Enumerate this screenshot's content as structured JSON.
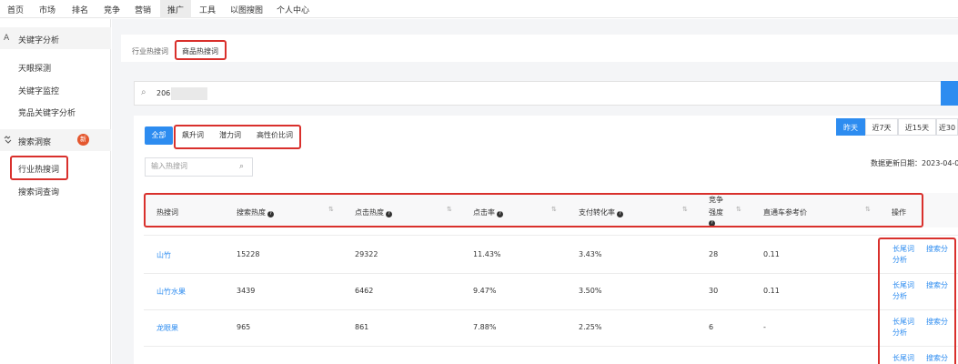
{
  "topnav": {
    "items": [
      "首页",
      "市场",
      "排名",
      "竞争",
      "营销",
      "推广",
      "工具",
      "以图搜图",
      "个人中心"
    ],
    "active_index": 5
  },
  "sidebar": {
    "group1": {
      "icon": "A",
      "label": "关键字分析"
    },
    "group1_items": [
      "天眼探测",
      "关键字监控",
      "竞品关键字分析"
    ],
    "group2": {
      "icon": "search-trend-icon",
      "label": "搜索洞察",
      "badge": "新"
    },
    "group2_items": [
      "行业热搜词",
      "搜索词查询"
    ],
    "selected_item": "行业热搜词"
  },
  "tabs": [
    "行业热搜词",
    "商品热搜词"
  ],
  "active_tab": "商品热搜词",
  "search": {
    "value": "206"
  },
  "category_filters": [
    "全部",
    "飙升词",
    "潜力词",
    "高性价比词"
  ],
  "time_ranges": [
    "昨天",
    "近7天",
    "近15天",
    "近30"
  ],
  "active_time_range": "昨天",
  "keyword_input": {
    "placeholder": "输入热搜词"
  },
  "update_date": "数据更新日期：2023-04-0",
  "table": {
    "columns": [
      "热搜词",
      "搜索热度",
      "点击热度",
      "点击率",
      "支付转化率",
      "竞争强度",
      "直通车参考价",
      "操作"
    ],
    "competition_header_lines": [
      "竞争",
      "强度"
    ],
    "rows": [
      {
        "keyword": "山竹",
        "search_heat": "15228",
        "click_heat": "29322",
        "ctr": "11.43%",
        "conversion": "3.43%",
        "competition": "28",
        "ref_price": "0.11"
      },
      {
        "keyword": "山竹水果",
        "search_heat": "3439",
        "click_heat": "6462",
        "ctr": "9.47%",
        "conversion": "3.50%",
        "competition": "30",
        "ref_price": "0.11"
      },
      {
        "keyword": "龙眼果",
        "search_heat": "965",
        "click_heat": "861",
        "ctr": "7.88%",
        "conversion": "2.25%",
        "competition": "6",
        "ref_price": "-"
      }
    ],
    "actions": {
      "long_tail": "长尾词分析",
      "search_analysis": "搜索分析",
      "long_tail_lines": [
        "长尾词",
        "分析"
      ],
      "search_analysis_lines": [
        "搜索分",
        "析"
      ]
    }
  },
  "colors": {
    "accent": "#2d8cf0",
    "highlight_box": "#d9302c",
    "badge": "#e4572e"
  }
}
